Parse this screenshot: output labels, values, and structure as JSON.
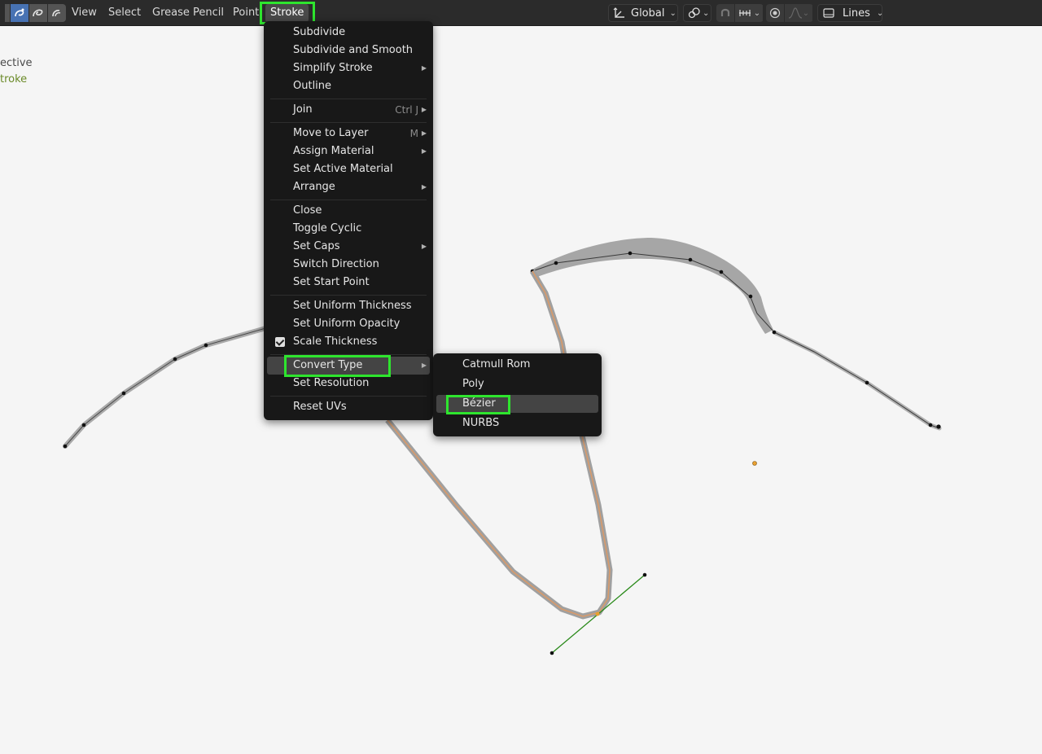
{
  "header": {
    "menus": [
      {
        "label": "View"
      },
      {
        "label": "Select"
      },
      {
        "label": "Grease Pencil"
      },
      {
        "label": "Point"
      },
      {
        "label": "Stroke"
      }
    ],
    "orientation": "Global",
    "interpolation": "Lines",
    "icons": [
      "gp-edit-icon",
      "gp-sculpt-icon",
      "gp-weight-icon",
      "transform-axes-icon",
      "pivot-icon",
      "snap-icon",
      "snap-increment-icon",
      "proportional-edit-icon",
      "falloff-icon",
      "interpolation-icon"
    ]
  },
  "overlay": {
    "line1": "ective",
    "line2": "troke",
    "line2_color": "#6a8a28"
  },
  "stroke_menu": {
    "items": [
      {
        "label": "Subdivide"
      },
      {
        "label": "Subdivide and Smooth"
      },
      {
        "label": "Simplify Stroke",
        "submenu": true
      },
      {
        "label": "Outline"
      },
      {
        "label": "Join",
        "shortcut": "Ctrl J",
        "submenu": true
      },
      {
        "label": "Move to Layer",
        "shortcut": "M",
        "submenu": true
      },
      {
        "label": "Assign Material",
        "submenu": true
      },
      {
        "label": "Set Active Material"
      },
      {
        "label": "Arrange",
        "submenu": true
      },
      {
        "label": "Close"
      },
      {
        "label": "Toggle Cyclic"
      },
      {
        "label": "Set Caps",
        "submenu": true
      },
      {
        "label": "Switch Direction"
      },
      {
        "label": "Set Start Point"
      },
      {
        "label": "Set Uniform Thickness"
      },
      {
        "label": "Set Uniform Opacity"
      },
      {
        "label": "Scale Thickness",
        "checked": true
      },
      {
        "label": "Convert Type",
        "submenu": true
      },
      {
        "label": "Set Resolution"
      },
      {
        "label": "Reset UVs"
      }
    ]
  },
  "convert_submenu": {
    "items": [
      {
        "label": "Catmull Rom"
      },
      {
        "label": "Poly"
      },
      {
        "label": "Bézier"
      },
      {
        "label": "NURBS"
      }
    ]
  },
  "colors": {
    "highlight": "#2ee52e",
    "accent": "#4772b3",
    "menu_bg": "#181818",
    "header_bg": "#2b2b2b",
    "viewport_bg": "#f5f5f5",
    "handle": "#2a8a1a",
    "selected_vertex": "#e8a030"
  }
}
